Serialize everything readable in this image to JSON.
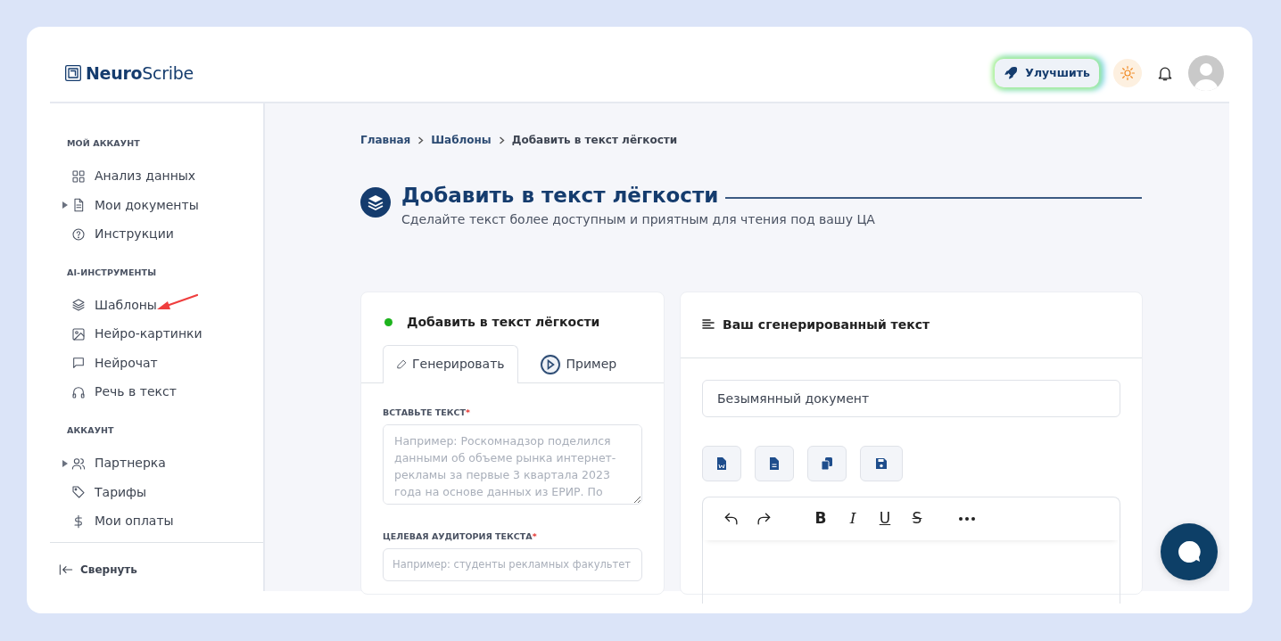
{
  "header": {
    "logo": "**Neuro**Scribe",
    "upgrade_button": "Улучшить"
  },
  "sidebar": {
    "sections": [
      {
        "title": "МОЙ АККАУНТ",
        "items": [
          {
            "kind": "grid",
            "label": "Анализ данных",
            "expandable": false,
            "pointed": false
          },
          {
            "kind": "doc",
            "label": "Мои документы",
            "expandable": true,
            "pointed": false
          },
          {
            "kind": "help",
            "label": "Инструкции",
            "expandable": false,
            "pointed": false
          }
        ]
      },
      {
        "title": "AI-ИНСТРУМЕНТЫ",
        "items": [
          {
            "kind": "layers",
            "label": "Шаблоны",
            "expandable": false,
            "pointed": true
          },
          {
            "kind": "image",
            "label": "Нейро-картинки",
            "expandable": false,
            "pointed": false
          },
          {
            "kind": "chat",
            "label": "Нейрочат",
            "expandable": false,
            "pointed": false
          },
          {
            "kind": "headphones",
            "label": "Речь в текст",
            "expandable": false,
            "pointed": false
          }
        ]
      },
      {
        "title": "АККАУНТ",
        "items": [
          {
            "kind": "users",
            "label": "Партнерка",
            "expandable": true,
            "pointed": false
          },
          {
            "kind": "tag",
            "label": "Тарифы",
            "expandable": false,
            "pointed": false
          },
          {
            "kind": "dollar",
            "label": "Мои оплаты",
            "expandable": false,
            "pointed": false
          }
        ]
      }
    ],
    "collapse": "Свернуть"
  },
  "breadcrumb": [
    {
      "label": "Главная",
      "current": false
    },
    {
      "label": "Шаблоны",
      "current": false
    },
    {
      "label": "Добавить в текст лёгкости",
      "current": true
    }
  ],
  "page": {
    "title": "Добавить в текст лёгкости",
    "subtitle": "Сделайте текст более доступным и приятным для чтения под вашу ЦА"
  },
  "form_card": {
    "title": "Добавить в текст лёгкости",
    "tabs": [
      {
        "label": "Генерировать",
        "kind": "edit",
        "selected": true
      },
      {
        "label": "Пример",
        "kind": "play",
        "selected": false
      }
    ],
    "fields": [
      {
        "kind": "textarea",
        "label": "ВСТАВЬТЕ ТЕКСТ",
        "required_mark": "*",
        "placeholder": "Например: Роскомнадзор поделился данными об объеме рынка интернет-рекламы за первые 3 квартала 2023 года на основе данных из ЕРИР. По"
      },
      {
        "kind": "input",
        "label": "ЦЕЛЕВАЯ АУДИТОРИЯ ТЕКСТА",
        "required_mark": "*",
        "placeholder": "Например: студенты рекламных факультет"
      }
    ]
  },
  "result_card": {
    "title": "Ваш сгенерированный текст",
    "document_name": "Безымянный документ",
    "editor_toolbar": [
      {
        "kind": "bold",
        "label": "B"
      },
      {
        "kind": "italic",
        "label": "I"
      },
      {
        "kind": "underline",
        "label": "U"
      },
      {
        "kind": "strike",
        "label": "S"
      }
    ]
  }
}
